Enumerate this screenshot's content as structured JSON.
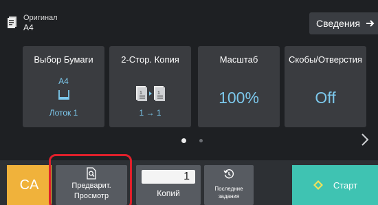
{
  "header": {
    "original_title": "Оригинал",
    "original_size": "A4",
    "info_label": "Сведения"
  },
  "tiles": [
    {
      "label": "Выбор Бумаги",
      "paper": "A4",
      "tray": "Лоток 1"
    },
    {
      "label": "2-Стор. Копия",
      "mode": "1 → 1"
    },
    {
      "label": "Масштаб",
      "value": "100%"
    },
    {
      "label": "Скобы/Отверстия",
      "value": "Off"
    }
  ],
  "pager": {
    "current": 1,
    "total": 2
  },
  "bottom": {
    "ca_label": "CA",
    "preview_line1": "Предварит.",
    "preview_line2": "Просмотр",
    "copies_value": "1",
    "copies_label": "Копий",
    "recent_line1": "Последние",
    "recent_line2": "задания",
    "start_label": "Старт"
  },
  "colors": {
    "accent_value": "#7cc8ec",
    "ca_button": "#f0b23b",
    "start_button": "#3fc3b2",
    "highlight_frame": "#e0202b"
  },
  "icons": {
    "original": "document-icon",
    "info": "arrow-right-icon",
    "tray": "tray-icon",
    "duplex": "duplex-pages-icon",
    "preview": "magnify-page-icon",
    "recent": "history-clock-icon",
    "start": "start-diamond-icon",
    "next": "chevron-right-icon"
  }
}
